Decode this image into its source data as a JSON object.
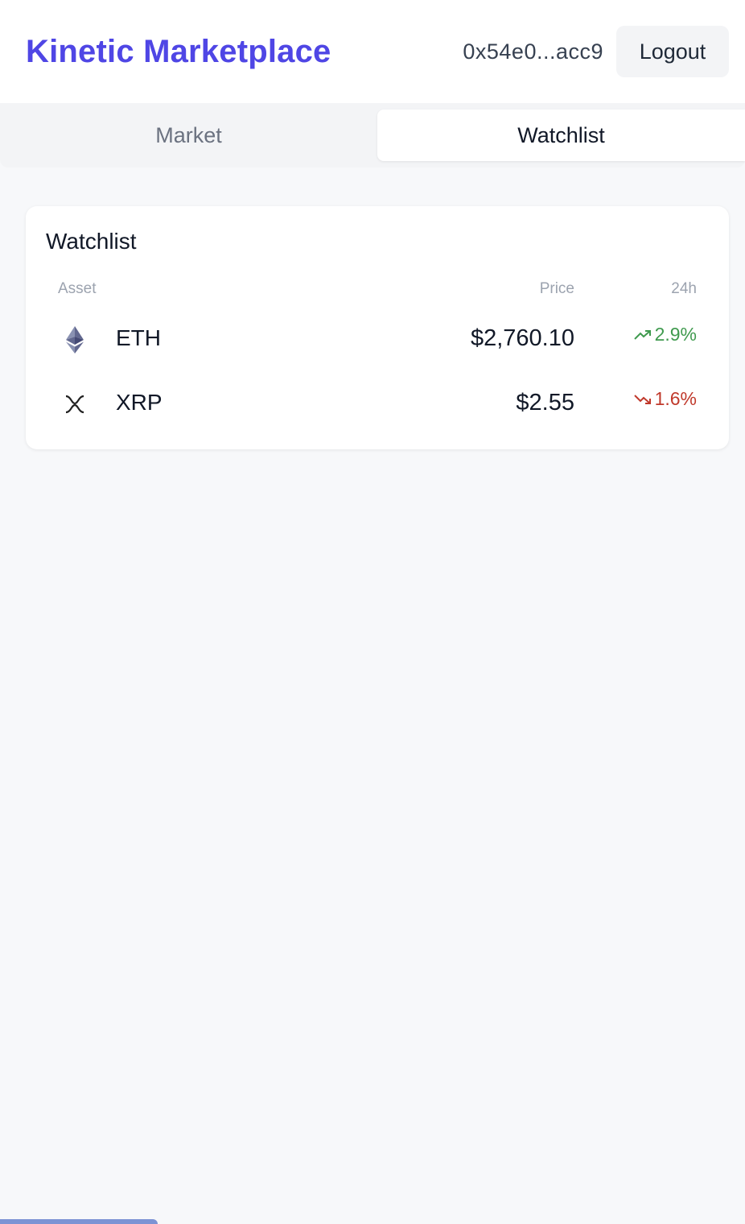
{
  "header": {
    "brand": "Kinetic Marketplace",
    "wallet_address": "0x54e0...acc9",
    "logout_label": "Logout"
  },
  "tabs": [
    {
      "label": "Market",
      "active": false
    },
    {
      "label": "Watchlist",
      "active": true
    }
  ],
  "watchlist": {
    "title": "Watchlist",
    "columns": {
      "asset": "Asset",
      "price": "Price",
      "change": "24h"
    },
    "rows": [
      {
        "symbol": "ETH",
        "icon": "ethereum-icon",
        "price": "$2,760.10",
        "change": "2.9%",
        "direction": "up"
      },
      {
        "symbol": "XRP",
        "icon": "xrp-icon",
        "price": "$2.55",
        "change": "1.6%",
        "direction": "down"
      }
    ]
  },
  "colors": {
    "brand": "#4f46e5",
    "positive": "#3f9a4e",
    "negative": "#c0392b",
    "background": "#f7f8fa"
  }
}
